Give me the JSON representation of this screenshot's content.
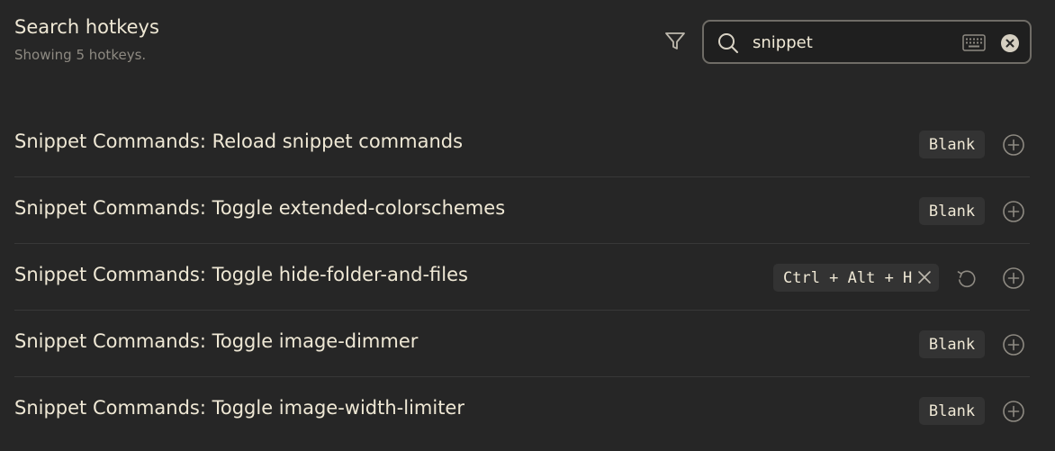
{
  "header": {
    "title": "Search hotkeys",
    "subtitle": "Showing 5 hotkeys."
  },
  "search": {
    "value": "snippet",
    "icons": {
      "filter": "filter-icon",
      "search": "search-icon",
      "keyboard": "keyboard-icon",
      "clear": "clear-icon"
    }
  },
  "hotkeys": [
    {
      "label": "Snippet Commands: Reload snippet commands",
      "hotkey": "Blank"
    },
    {
      "label": "Snippet Commands: Toggle extended-colorschemes",
      "hotkey": "Blank"
    },
    {
      "label": "Snippet Commands: Toggle hide-folder-and-files",
      "hotkey": "Ctrl + Alt + H"
    },
    {
      "label": "Snippet Commands: Toggle image-dimmer",
      "hotkey": "Blank"
    },
    {
      "label": "Snippet Commands: Toggle image-width-limiter",
      "hotkey": "Blank"
    }
  ],
  "colors": {
    "background": "#262626",
    "text": "#efe8d5",
    "muted": "#8e8a82",
    "chip": "#333333",
    "divider": "#383838"
  }
}
